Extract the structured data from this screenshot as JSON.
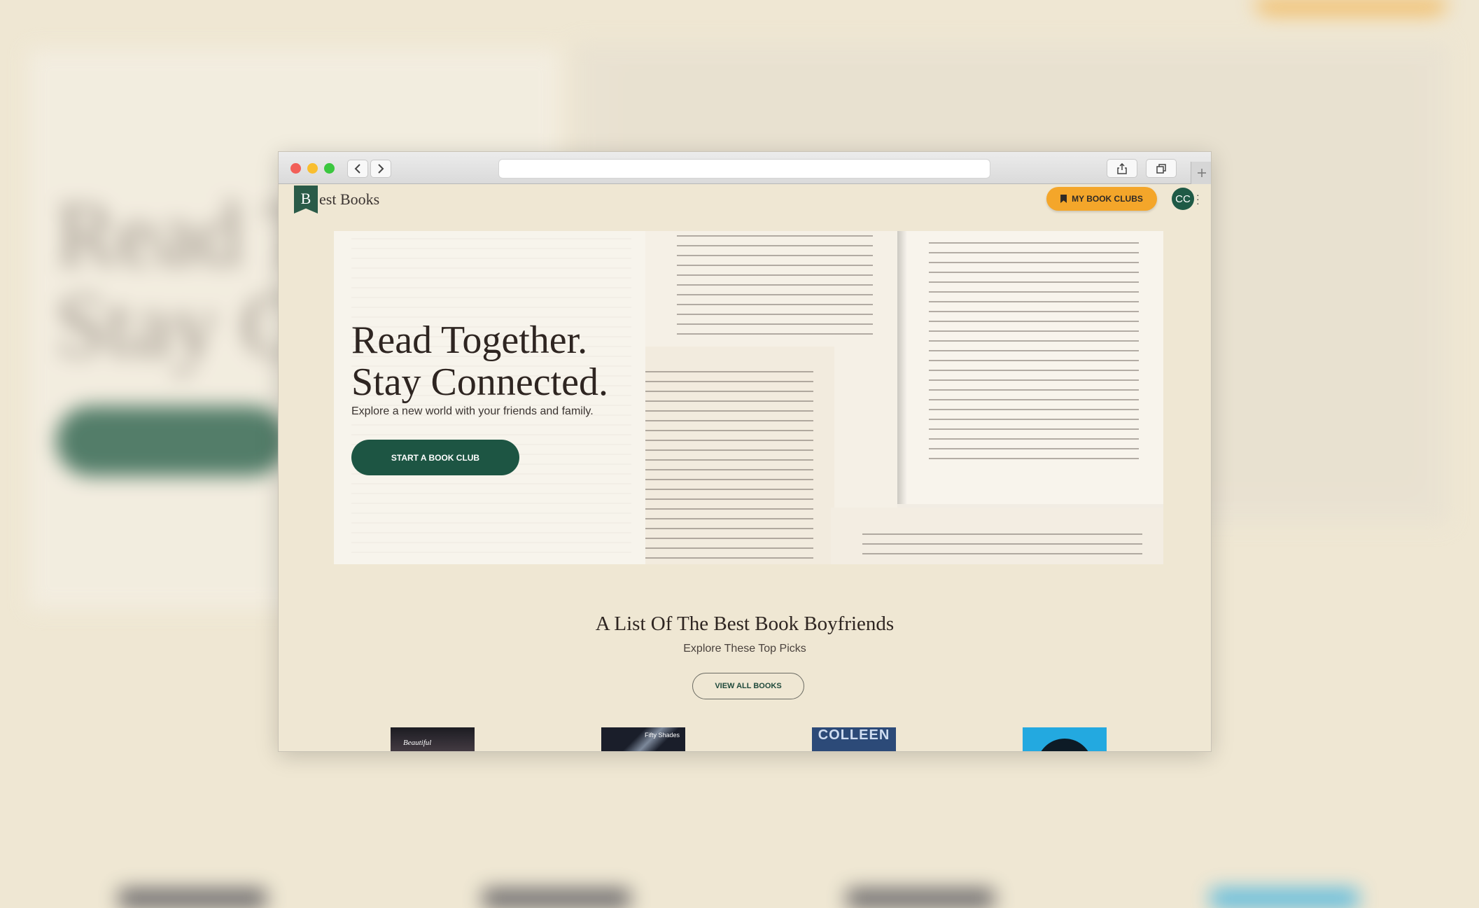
{
  "backdrop": {
    "title": "Read To\nStay Co"
  },
  "browser": {
    "back_icon": "chevron-left-icon",
    "forward_icon": "chevron-right-icon",
    "share_icon": "share-icon",
    "tabs_icon": "tabs-icon",
    "new_tab_icon": "plus-icon"
  },
  "header": {
    "logo_letter": "B",
    "logo_text": "est Books",
    "my_book_clubs_label": "MY BOOK CLUBS",
    "avatar_initials": "CC"
  },
  "hero": {
    "title_line1": "Read Together.",
    "title_line2": "Stay Connected.",
    "subtitle": "Explore a new world with your friends and family.",
    "cta_label": "START A BOOK CLUB"
  },
  "section": {
    "title": "A List Of The Best Book Boyfriends",
    "subtitle": "Explore These Top Picks",
    "view_all_label": "VIEW ALL BOOKS"
  },
  "books": [
    {
      "cover_text": "Beautiful"
    },
    {
      "cover_text": "Fifty Shades"
    },
    {
      "cover_text": "COLLEEN"
    },
    {
      "cover_text": ""
    }
  ],
  "colors": {
    "background": "#efe7d3",
    "brand_green": "#1d5543",
    "accent_orange": "#f4a62a"
  }
}
